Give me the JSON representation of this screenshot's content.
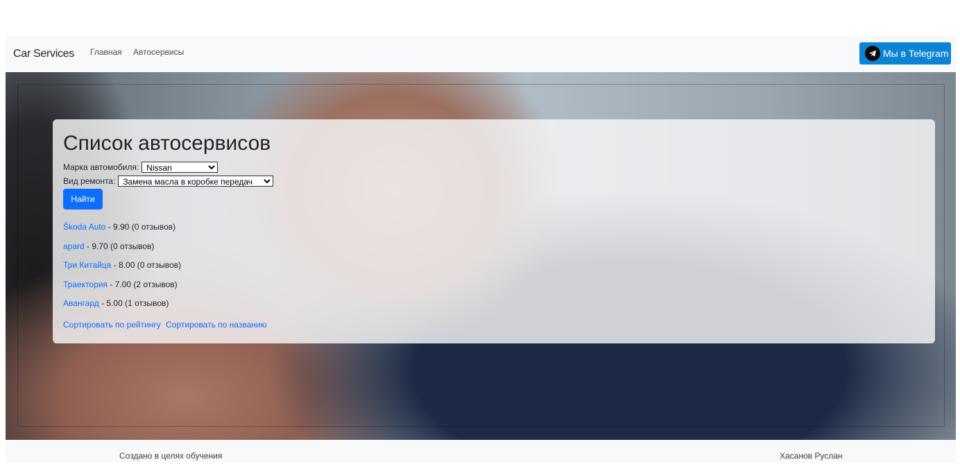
{
  "navbar": {
    "brand": "Car Services",
    "links": [
      "Главная",
      "Автосервисы"
    ],
    "telegram_button": "Мы в Telegram"
  },
  "main": {
    "title": "Список автосервисов",
    "brand_label": "Марка автомобиля:",
    "brand_value": "Nissan",
    "work_label": "Вид ремонта:",
    "work_value": "Замена масла в коробке передач",
    "find_button": "Найти",
    "results": [
      {
        "name": "Škoda Auto",
        "rest": " - 9.90 (0 отзывов)"
      },
      {
        "name": "apard",
        "rest": " - 9.70 (0 отзывов)"
      },
      {
        "name": "Три Китайца",
        "rest": " - 8.00 (0 отзывов)"
      },
      {
        "name": "Траектория",
        "rest": " - 7.00 (2 отзывов)"
      },
      {
        "name": "Авангард",
        "rest": " - 5.00 (1 отзывов)"
      }
    ],
    "sort_by_rating": "Сортировать по рейтингу",
    "sort_by_name": "Сортировать по названию"
  },
  "footer": {
    "left": "Создано в целях обучения",
    "right": "Хасанов Руслан"
  },
  "colors": {
    "accent": "#0d6efd",
    "telegram": "#0d83d6",
    "navbar_bg": "#f8f9fa"
  }
}
